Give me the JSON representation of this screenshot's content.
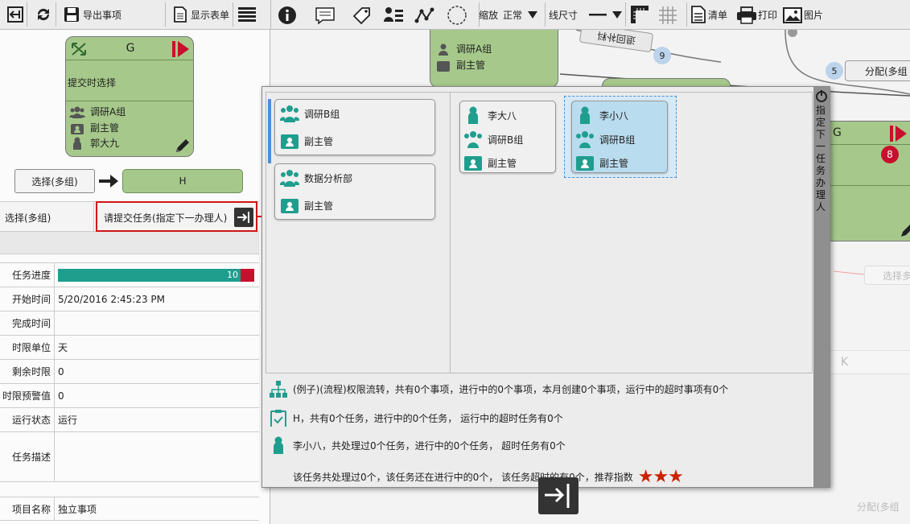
{
  "toolbar_left": {
    "export_label": "导出事项",
    "show_form_label": "显示表单"
  },
  "toolbar_right": {
    "zoom_label": "缩放",
    "zoom_value": "正常",
    "line_label": "线尺寸",
    "list_label": "清单",
    "print_label": "打印",
    "image_label": "图片"
  },
  "task_card": {
    "title": "G",
    "body": "提交时选择",
    "group": "调研A组",
    "role": "副主管",
    "person": "郭大九"
  },
  "selection": {
    "button_label": "选择(多组)",
    "target": "H",
    "row_label": "选择(多组)",
    "submit_label": "请提交任务(指定下一办理人)"
  },
  "details": {
    "progress_label": "任务进度",
    "progress_value": 10,
    "progress_percent": 0.93,
    "rows": [
      {
        "label": "开始时间",
        "value": "5/20/2016 2:45:23 PM"
      },
      {
        "label": "完成时间",
        "value": ""
      },
      {
        "label": "时限单位",
        "value": "天"
      },
      {
        "label": "剩余时限",
        "value": "0"
      },
      {
        "label": "时限预警值",
        "value": "0"
      },
      {
        "label": "运行状态",
        "value": "运行"
      },
      {
        "label": "任务描述",
        "value": ""
      }
    ],
    "project_label": "项目名称",
    "project_value": "独立事项"
  },
  "canvas": {
    "top_card_group": "调研A组",
    "top_card_role": "副主管",
    "edge_label_1": "退回补料",
    "badge_1": "9",
    "badge_2": "5",
    "edge_label_2": "分配(多组",
    "right_card_title": "G",
    "right_card_badge": "8",
    "ghost_1": "选择多",
    "ghost_2": "K",
    "ghost_3": "分配(多组"
  },
  "popup": {
    "side_label": "指定下一任务办理人",
    "groups": [
      {
        "name": "调研B组",
        "role": "副主管"
      },
      {
        "name": "数据分析部",
        "role": "副主管"
      }
    ],
    "people": [
      {
        "name": "李大八",
        "group": "调研B组",
        "role": "副主管"
      },
      {
        "name": "李小八",
        "group": "调研B组",
        "role": "副主管"
      }
    ],
    "info_process": "(例子)(流程)权限流转，共有0个事项，进行中的0个事项，本月创建0个事项，运行中的超时事项有0个",
    "info_task": "H，共有0个任务，进行中的0个任务， 运行中的超时任务有0个",
    "info_person": "李小八，共处理过0个任务，进行中的0个任务， 超时任务有0个",
    "info_rating": "该任务共处理过0个，该任务还在进行中的0个， 该任务超时的有0个，推荐指数",
    "stars": 3
  },
  "colors": {
    "accent": "#1f9e8e",
    "card_green": "#a6c98b",
    "selected": "#b9dcef",
    "star": "#cc2200",
    "red": "#c8102e"
  }
}
